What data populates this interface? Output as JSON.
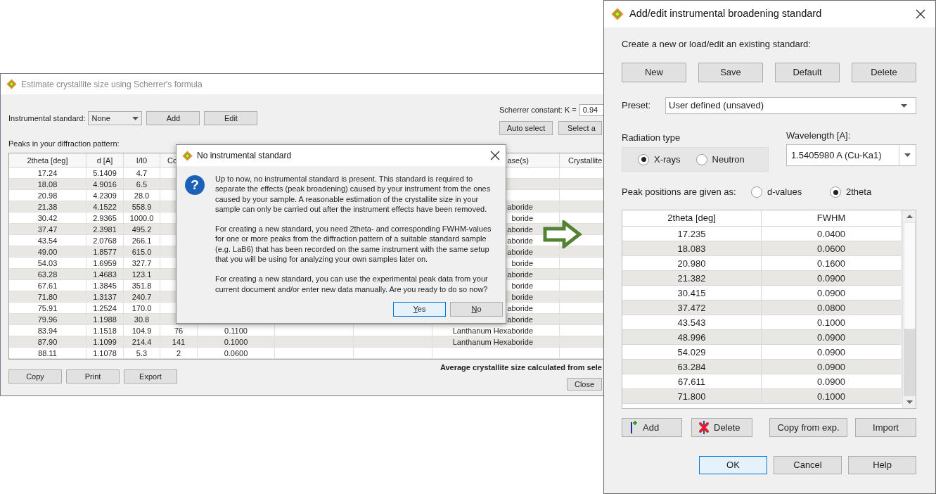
{
  "scherrer_window": {
    "title": "Estimate crystallite size using Scherrer's formula",
    "active": false,
    "instrumental_standard": {
      "label": "Instrumental standard:",
      "value": "None"
    },
    "standard_buttons": [
      "Add",
      "Edit"
    ],
    "scherrer_constant": {
      "label": "Scherrer constant: K =",
      "value": "0.94"
    },
    "select_buttons": [
      "Auto select",
      "Select a"
    ],
    "table_label": "Peaks in your diffraction pattern:",
    "table": {
      "columns": [
        {
          "header": "2theta [deg]"
        },
        {
          "header": "d [A]"
        },
        {
          "header": "I/I0"
        },
        {
          "header": "Co"
        },
        {},
        {},
        {},
        {
          "header": "ase(s)"
        },
        {
          "header": "Crystallite"
        }
      ],
      "rows": [
        [
          "17.24",
          "5.1409",
          "4.7",
          null,
          null,
          null,
          null,
          null,
          null
        ],
        [
          "18.08",
          "4.9016",
          "6.5",
          null,
          null,
          null,
          null,
          null,
          null
        ],
        [
          "20.98",
          "4.2309",
          "28.0",
          null,
          null,
          null,
          null,
          null,
          null
        ],
        [
          "21.38",
          "4.1522",
          "558.9",
          null,
          null,
          null,
          null,
          "aboride",
          null
        ],
        [
          "30.42",
          "2.9365",
          "1000.0",
          null,
          null,
          null,
          null,
          "boride",
          null
        ],
        [
          "37.47",
          "2.3981",
          "495.2",
          null,
          null,
          null,
          null,
          "aboride",
          null
        ],
        [
          "43.54",
          "2.0768",
          "266.1",
          null,
          null,
          null,
          null,
          "aboride",
          null
        ],
        [
          "49.00",
          "1.8577",
          "615.0",
          null,
          null,
          null,
          null,
          "aboride",
          null
        ],
        [
          "54.03",
          "1.6959",
          "327.7",
          null,
          null,
          null,
          null,
          "boride",
          null
        ],
        [
          "63.28",
          "1.4683",
          "123.1",
          null,
          null,
          null,
          null,
          "aboride",
          null
        ],
        [
          "67.61",
          "1.3845",
          "351.8",
          null,
          null,
          null,
          null,
          "boride",
          null
        ],
        [
          "71.80",
          "1.3137",
          "240.7",
          null,
          null,
          null,
          null,
          "boride",
          null
        ],
        [
          "75.91",
          "1.2524",
          "170.0",
          null,
          null,
          null,
          null,
          "aboride",
          null
        ],
        [
          "79.96",
          "1.1988",
          "30.8",
          null,
          null,
          null,
          null,
          "aboride",
          null
        ],
        [
          "83.94",
          "1.1518",
          "104.9",
          "76",
          "0.1100",
          null,
          null,
          "Lanthanum Hexaboride",
          null
        ],
        [
          "87.90",
          "1.1099",
          "214.4",
          "141",
          "0.1000",
          null,
          null,
          "Lanthanum Hexaboride",
          null
        ],
        [
          "88.11",
          "1.1078",
          "5.3",
          "2",
          "0.0600",
          null,
          null,
          null,
          null
        ]
      ]
    },
    "average_label": "Average crystallite size calculated from sele",
    "bottom_buttons": [
      "Copy",
      "Print",
      "Export"
    ],
    "close_button": "Close"
  },
  "message_dialog": {
    "title": "No instrumental standard",
    "active": true,
    "icon_glyph": "?",
    "paragraphs": [
      "Up to now, no instrumental standard is present. This standard is required to separate the effects (peak broadening) caused by your instrument from the ones caused by your sample. A reasonable estimation of the crystallite size in your sample can only be carried out after the instrument effects have been removed.",
      "For creating a new standard, you need 2theta- and corresponding FWHM-values for one or more peaks from the diffraction pattern of a suitable standard sample (e.g. LaB6) that has been recorded on the same instrument with the same setup that you will be using for analyzing your own samples later on.",
      "For creating a new standard, you can use the experimental peak data from your current document and/or enter new data manually. Are you ready to do so now?"
    ],
    "buttons": [
      {
        "label": "Yes",
        "default": true
      },
      {
        "label": "No",
        "default": false
      }
    ]
  },
  "standard_dialog": {
    "title": "Add/edit instrumental broadening standard",
    "active": true,
    "intro": "Create a new or load/edit an existing standard:",
    "standard_buttons": [
      "New",
      "Save",
      "Default",
      "Delete"
    ],
    "preset": {
      "label": "Preset:",
      "value": "User defined (unsaved)"
    },
    "radiation_type": {
      "label": "Radiation type",
      "options": [
        {
          "label": "X-rays",
          "selected": true
        },
        {
          "label": "Neutron",
          "selected": false
        }
      ]
    },
    "wavelength": {
      "label": "Wavelength [A]:",
      "value": "1.5405980 A (Cu-Ka1)"
    },
    "peak_positions": {
      "label": "Peak positions are given as:",
      "options": [
        {
          "label": "d-values",
          "selected": false
        },
        {
          "label": "2theta",
          "selected": true
        }
      ]
    },
    "table": {
      "columns": [
        "2theta [deg]",
        "FWHM"
      ],
      "rows": [
        [
          "17.235",
          "0.0400"
        ],
        [
          "18.083",
          "0.0600"
        ],
        [
          "20.980",
          "0.1600"
        ],
        [
          "21.382",
          "0.0900"
        ],
        [
          "30.415",
          "0.0900"
        ],
        [
          "37.472",
          "0.0800"
        ],
        [
          "43.543",
          "0.1000"
        ],
        [
          "48.996",
          "0.0900"
        ],
        [
          "54.029",
          "0.0900"
        ],
        [
          "63.284",
          "0.0900"
        ],
        [
          "67.611",
          "0.0900"
        ],
        [
          "71.800",
          "0.1000"
        ]
      ]
    },
    "table_buttons": [
      {
        "kind": "add",
        "label": "Add"
      },
      {
        "kind": "delete",
        "label": "Delete"
      },
      {
        "kind": "plain",
        "label": "Copy from exp."
      },
      {
        "kind": "plain",
        "label": "Import"
      }
    ],
    "dialog_buttons": [
      {
        "label": "OK",
        "default": true
      },
      {
        "label": "Cancel",
        "default": false
      },
      {
        "label": "Help",
        "default": false
      }
    ]
  }
}
